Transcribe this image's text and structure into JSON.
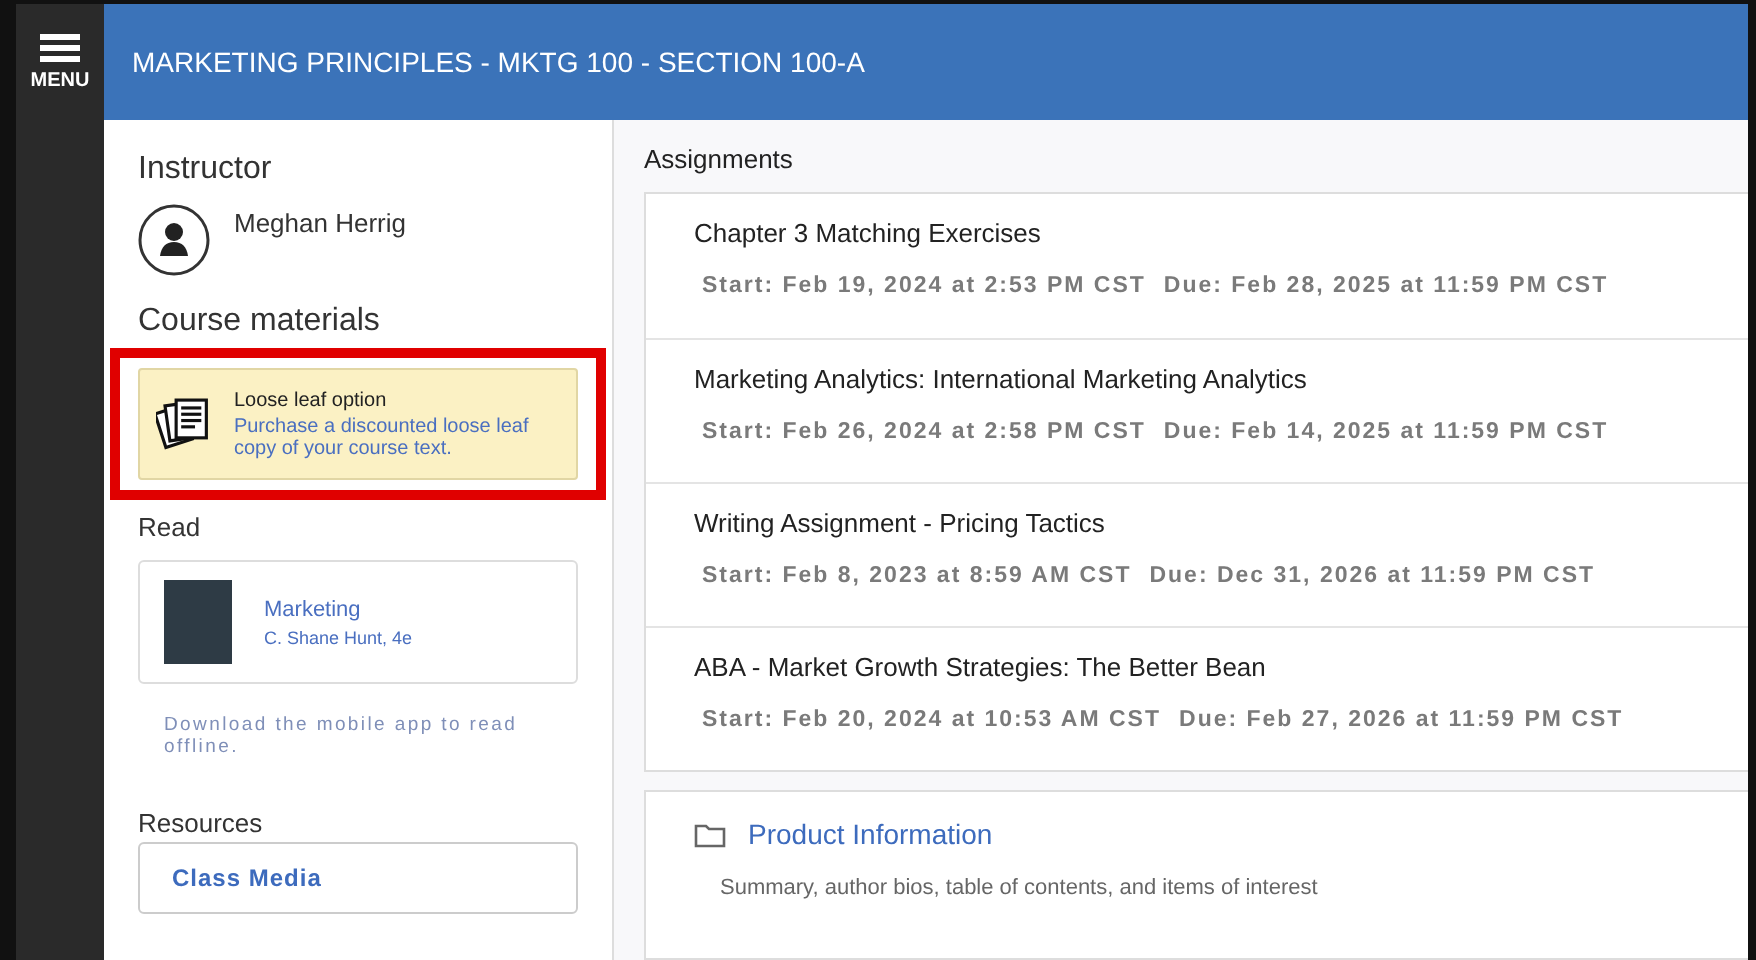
{
  "menu": {
    "label": "MENU"
  },
  "header": {
    "title": "MARKETING PRINCIPLES - MKTG 100 - SECTION 100-A"
  },
  "sidebar": {
    "instructor_heading": "Instructor",
    "instructor_name": "Meghan Herrig",
    "materials_heading": "Course materials",
    "loose_leaf": {
      "title": "Loose leaf option",
      "description": "Purchase a discounted loose leaf copy of your course text."
    },
    "read_heading": "Read",
    "book": {
      "title": "Marketing",
      "author": "C. Shane Hunt, 4e"
    },
    "mobile_note": "Download the mobile app to read offline.",
    "resources_heading": "Resources",
    "resources": [
      "Class Media"
    ]
  },
  "assignments": {
    "heading": "Assignments",
    "items": [
      {
        "title": "Chapter 3 Matching Exercises",
        "start": "Start: Feb 19, 2024 at 2:53 PM CST",
        "due": "Due: Feb 28, 2025 at 11:59 PM CST"
      },
      {
        "title": "Marketing Analytics: International Marketing Analytics",
        "start": "Start: Feb 26, 2024 at 2:58 PM CST",
        "due": "Due: Feb 14, 2025 at 11:59 PM CST"
      },
      {
        "title": "Writing Assignment - Pricing Tactics",
        "start": "Start: Feb 8, 2023 at 8:59 AM CST",
        "due": "Due: Dec 31, 2026 at 11:59 PM CST"
      },
      {
        "title": "ABA - Market Growth Strategies: The Better Bean",
        "start": "Start: Feb 20, 2024 at 10:53 AM CST",
        "due": "Due: Feb 27, 2026 at 11:59 PM CST"
      }
    ]
  },
  "folder": {
    "title": "Product Information",
    "description": "Summary, author bios, table of contents, and items of interest"
  }
}
